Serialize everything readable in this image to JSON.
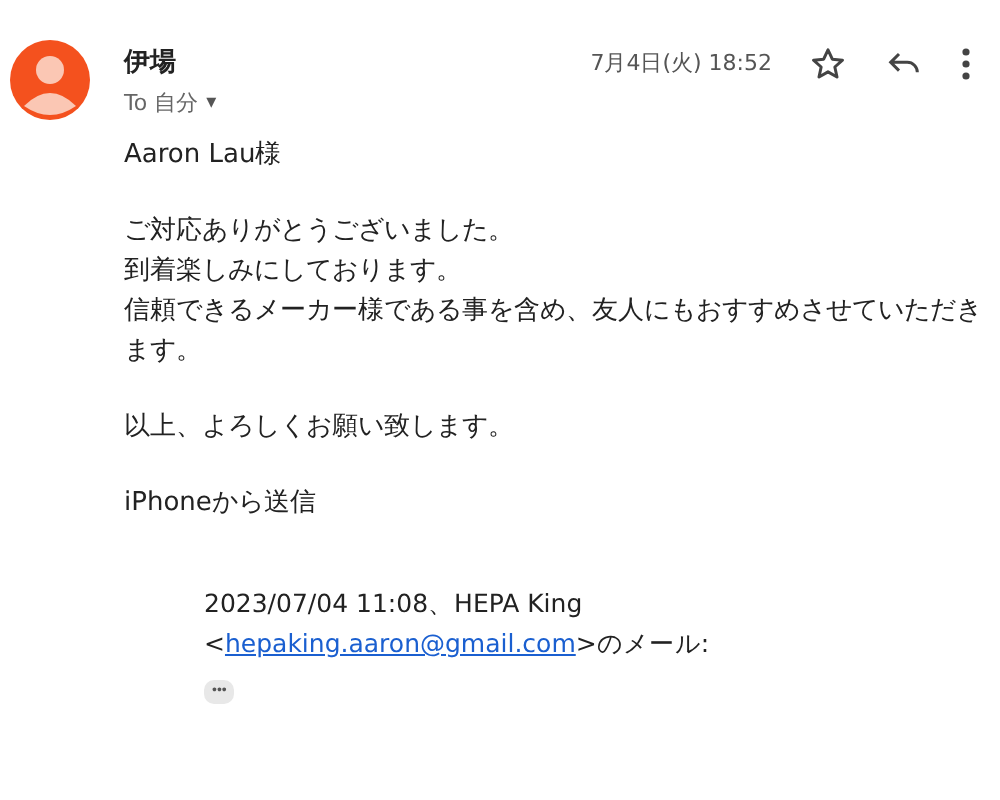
{
  "message": {
    "sender": "伊場",
    "recipient": "To 自分",
    "recipient_caret": "▾",
    "date": "7月4日(火) 18:52",
    "starred": false
  },
  "body": [
    [
      "Aaron Lau様"
    ],
    [
      "ご対応ありがとうございました。",
      "到着楽しみにしております。",
      "信頼できるメーカー様である事を含め、友人にもおすすめさせていただきます。"
    ],
    [
      "以上、よろしくお願い致します。"
    ],
    [
      "iPhoneから送信"
    ]
  ],
  "quote": {
    "header": "2023/07/04 11:08、HEPA King",
    "prefix": "<",
    "email": "hepaking.aaron@gmail.com",
    "suffix": ">のメール:",
    "more": "•••"
  }
}
